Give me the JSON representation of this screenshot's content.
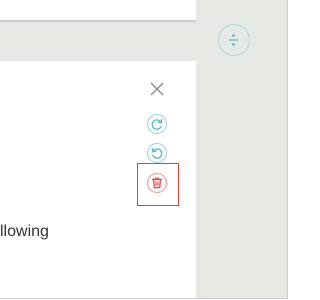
{
  "toolbar": {
    "divide_symbol": "÷",
    "close_icon": "close-icon",
    "redo_icon": "redo-icon",
    "undo_icon": "undo-icon",
    "delete_icon": "trash-icon"
  },
  "content": {
    "visible_text": "llowing"
  },
  "colors": {
    "accent_teal": "#5bbccc",
    "highlight_red": "#e0413b",
    "trash_red": "#e04a45",
    "panel_gray": "#e6e8e4"
  }
}
